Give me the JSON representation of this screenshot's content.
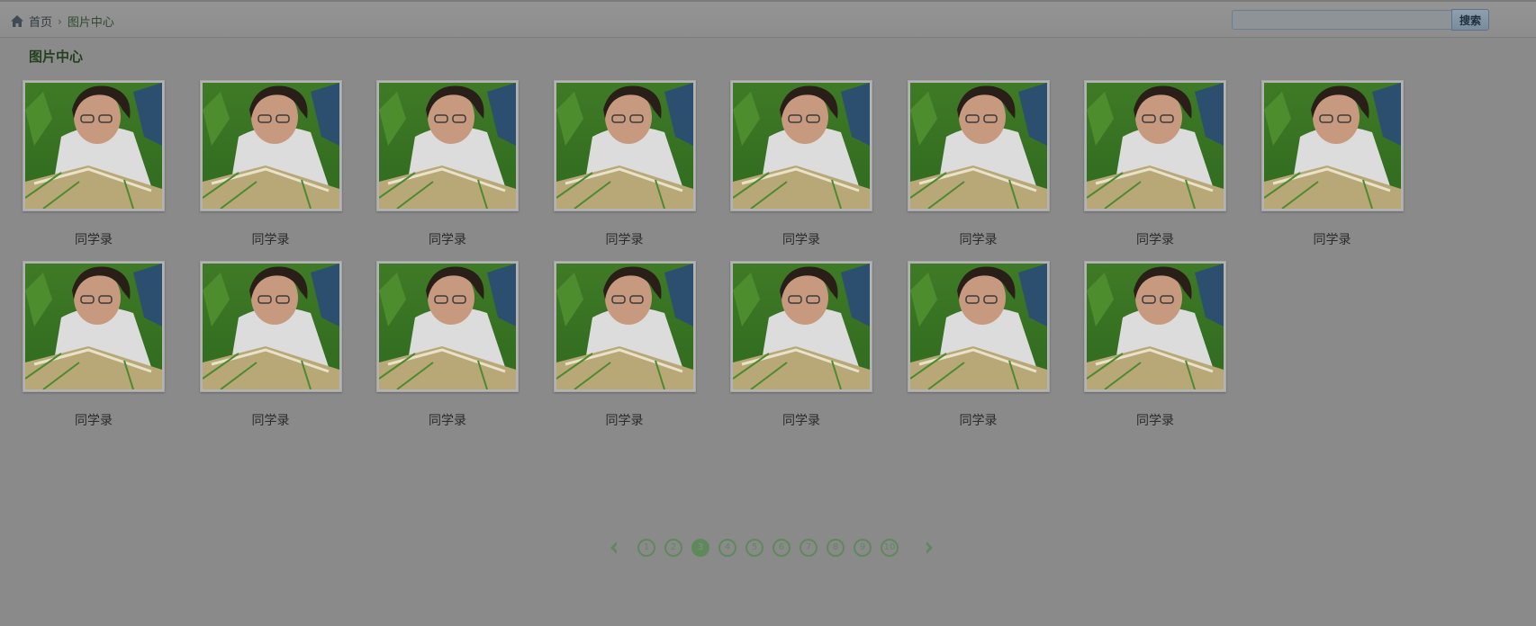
{
  "breadcrumb": {
    "home": "首页",
    "separator": "›",
    "current": "图片中心"
  },
  "search": {
    "placeholder": "",
    "button_label": "搜索"
  },
  "section_title": "图片中心",
  "gallery": [
    {
      "caption": "同学录"
    },
    {
      "caption": "同学录"
    },
    {
      "caption": "同学录"
    },
    {
      "caption": "同学录"
    },
    {
      "caption": "同学录"
    },
    {
      "caption": "同学录"
    },
    {
      "caption": "同学录"
    },
    {
      "caption": "同学录"
    },
    {
      "caption": "同学录"
    },
    {
      "caption": "同学录"
    },
    {
      "caption": "同学录"
    },
    {
      "caption": "同学录"
    },
    {
      "caption": "同学录"
    },
    {
      "caption": "同学录"
    },
    {
      "caption": "同学录"
    }
  ],
  "pagination": {
    "pages": [
      "1",
      "2",
      "3",
      "4",
      "5",
      "6",
      "7",
      "8",
      "9",
      "10"
    ],
    "current": "3",
    "prev_icon": "chevron-left-icon",
    "next_icon": "chevron-right-icon"
  },
  "colors": {
    "accent": "#5e8a5a",
    "overlay_bg": "#8a8a8a"
  }
}
